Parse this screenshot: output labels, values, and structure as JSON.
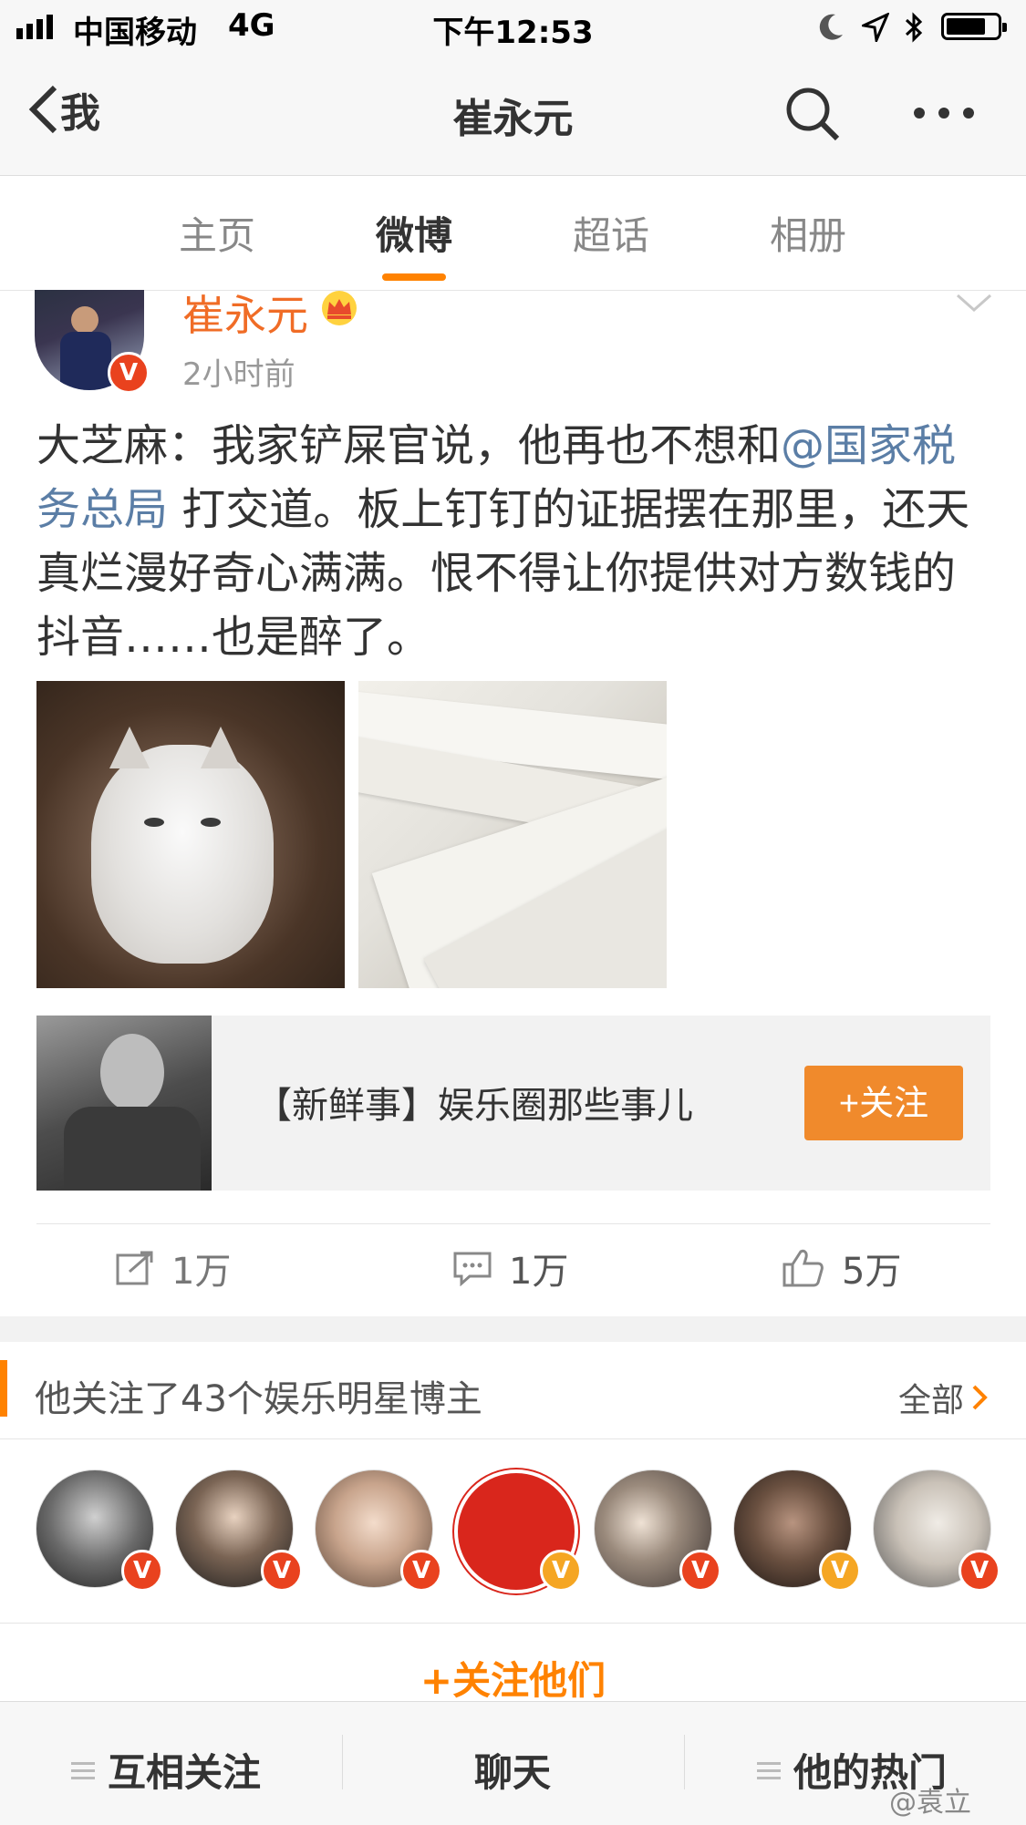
{
  "status_bar": {
    "carrier": "中国移动",
    "network": "4G",
    "time": "下午12:53"
  },
  "nav": {
    "back_label": "我",
    "title": "崔永元"
  },
  "tabs": [
    {
      "label": "主页",
      "active": false
    },
    {
      "label": "微博",
      "active": true
    },
    {
      "label": "超话",
      "active": false
    },
    {
      "label": "相册",
      "active": false
    }
  ],
  "post": {
    "author": "崔永元",
    "time": "2小时前",
    "text_part1": "大芝麻：我家铲屎官说，他再也不想和",
    "mention": "@国家税务总局",
    "text_part2": " 打交道。板上钉钉的证据摆在那里，还天真烂漫好奇心满满。恨不得让你提供对方数钱的抖音……也是醉了。",
    "card_title": "【新鲜事】娱乐圈那些事儿",
    "card_follow_label": "+关注",
    "actions": {
      "repost": "1万",
      "comment": "1万",
      "like": "5万"
    }
  },
  "following_section": {
    "title": "他关注了43个娱乐明星博主",
    "all_label": "全部",
    "follow_them_label": "+关注他们"
  },
  "bottom_bar": {
    "mutual": "互相关注",
    "chat": "聊天",
    "hot": "他的热门"
  },
  "watermark": "@袁立",
  "colors": {
    "accent": "#ff8200",
    "name": "#f06c26",
    "mention": "#5b7ea6",
    "verified_red": "#e9421e",
    "verified_yellow": "#f5a623"
  }
}
